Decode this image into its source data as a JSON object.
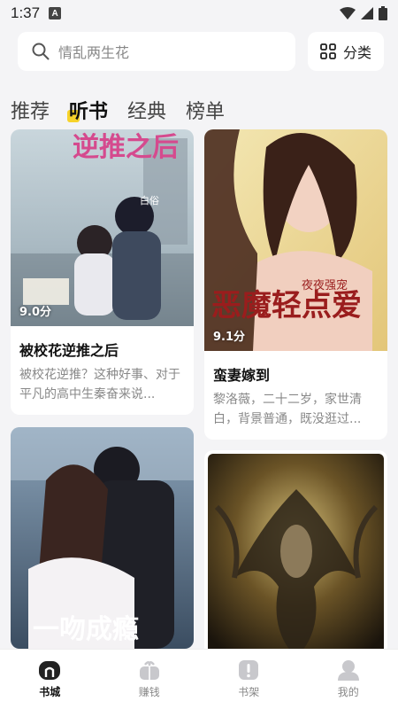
{
  "status": {
    "time": "1:37",
    "notif_badge": "A"
  },
  "search": {
    "placeholder": "情乱两生花",
    "category_label": "分类"
  },
  "tabs": [
    {
      "label": "推荐"
    },
    {
      "label": "听书"
    },
    {
      "label": "经典"
    },
    {
      "label": "榜单"
    }
  ],
  "books": [
    {
      "title": "被校花逆推之后",
      "score": "9.0分",
      "desc": "被校花逆推？这种好事、对于平凡的高中生秦奋来说...",
      "cover_title": "逆推之后",
      "cover_author": "白俗"
    },
    {
      "title": "蛮妻嫁到",
      "score": "9.1分",
      "desc": "黎洛薇，二十二岁，家世清白，背景普通，既没逛过...",
      "cover_title": "恶魔轻点爱",
      "cover_tag": "夜夜强宠"
    },
    {
      "cover_title": "一吻成瘾"
    },
    {
      "cover_title": ""
    }
  ],
  "nav": [
    {
      "label": "书城",
      "icon": "home-icon"
    },
    {
      "label": "赚钱",
      "icon": "gift-icon"
    },
    {
      "label": "书架",
      "icon": "bookshelf-icon"
    },
    {
      "label": "我的",
      "icon": "profile-icon"
    }
  ],
  "colors": {
    "accent": "#f7d32a",
    "background": "#f4f4f6"
  }
}
